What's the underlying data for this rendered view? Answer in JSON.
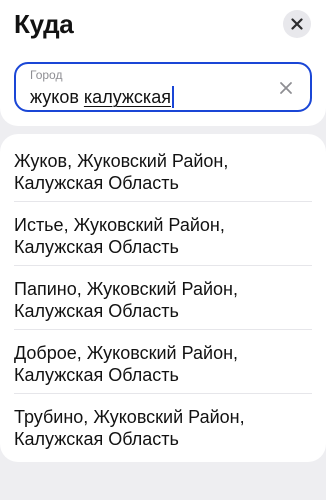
{
  "header": {
    "title": "Куда",
    "close_icon": "close-icon"
  },
  "search": {
    "label": "Город",
    "value_part1": "жуков ",
    "value_part2": "калужская",
    "clear_icon": "clear-icon"
  },
  "results": [
    {
      "line1": "Жуков, Жуковский Район,",
      "line2": "Калужская Область"
    },
    {
      "line1": "Истье, Жуковский Район,",
      "line2": "Калужская Область"
    },
    {
      "line1": "Папино, Жуковский Район,",
      "line2": "Калужская Область"
    },
    {
      "line1": "Доброе, Жуковский Район,",
      "line2": "Калужская Область"
    },
    {
      "line1": "Трубино, Жуковский Район,",
      "line2": "Калужская Область"
    }
  ],
  "colors": {
    "accent": "#1a46d6",
    "background": "#eeeef1",
    "card": "#ffffff",
    "text": "#121212",
    "muted": "#8e8e93"
  }
}
